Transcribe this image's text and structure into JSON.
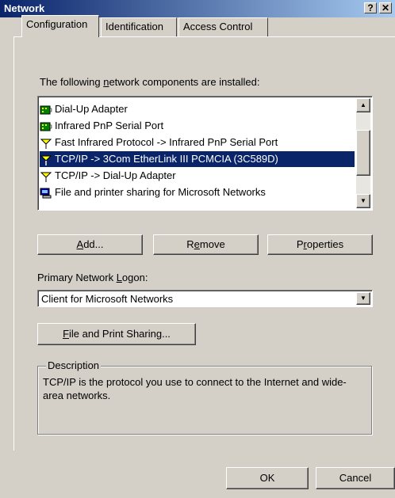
{
  "window": {
    "title": "Network",
    "help_label": "?",
    "close_label": "✕"
  },
  "tabs": [
    {
      "label": "Configuration",
      "active": true
    },
    {
      "label": "Identification",
      "active": false
    },
    {
      "label": "Access Control",
      "active": false
    }
  ],
  "components": {
    "label_pre": "The following ",
    "label_u": "n",
    "label_post": "etwork components are installed:",
    "items": [
      {
        "label": "Dial-Up Adapter",
        "icon": "network-adapter-icon"
      },
      {
        "label": "Infrared PnP Serial Port",
        "icon": "network-adapter-icon"
      },
      {
        "label": "Fast Infrared Protocol -> Infrared PnP Serial Port",
        "icon": "protocol-icon"
      },
      {
        "label": "TCP/IP -> 3Com EtherLink III PCMCIA (3C589D)",
        "icon": "protocol-icon",
        "selected": true
      },
      {
        "label": "TCP/IP -> Dial-Up Adapter",
        "icon": "protocol-icon"
      },
      {
        "label": "File and printer sharing for Microsoft Networks",
        "icon": "service-icon"
      }
    ]
  },
  "buttons": {
    "add_u": "A",
    "add_rest": "dd...",
    "remove_pre": "R",
    "remove_u": "e",
    "remove_post": "move",
    "properties_pre": "P",
    "properties_u": "r",
    "properties_post": "operties",
    "file_print_u": "F",
    "file_print_rest": "ile and Print Sharing...",
    "ok": "OK",
    "cancel": "Cancel"
  },
  "logon": {
    "label_pre": "Primary Network ",
    "label_u": "L",
    "label_post": "ogon:",
    "value": "Client for Microsoft Networks"
  },
  "description": {
    "legend": "Description",
    "text": "TCP/IP is the protocol you use to connect to the Internet and wide-area networks."
  },
  "colors": {
    "titlebar": "#0a246a",
    "selection": "#0a246a",
    "face": "#d4d0c8"
  }
}
